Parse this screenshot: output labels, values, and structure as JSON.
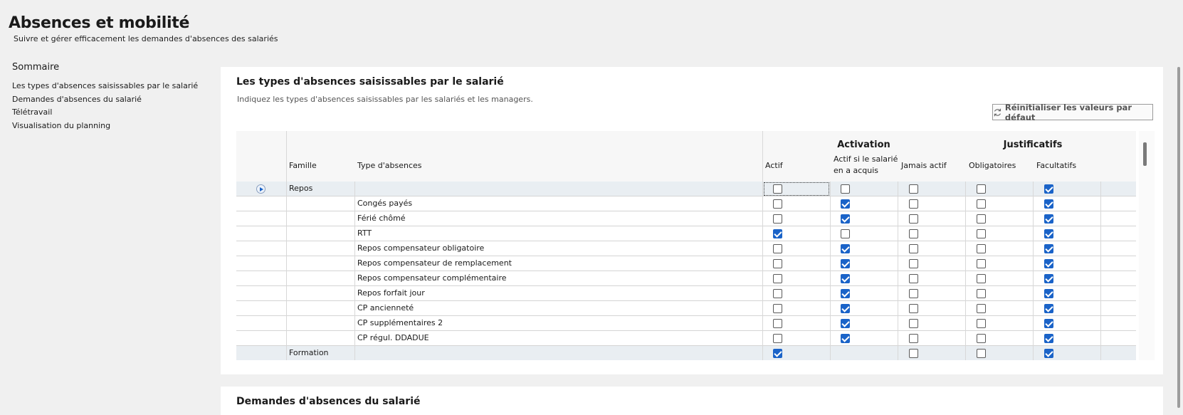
{
  "header": {
    "title": "Absences et mobilité",
    "subtitle": "Suivre et gérer efficacement les demandes d'absences des salariés"
  },
  "toc": {
    "title": "Sommaire",
    "items": [
      "Les types d'absences saisissables par le salarié",
      "Demandes d'absences du salarié",
      "Télétravail",
      "Visualisation du planning"
    ]
  },
  "section1": {
    "title": "Les types d'absences saisissables par le salarié",
    "description": "Indiquez les types d'absences saisissables par les salariés et les managers.",
    "reset_label": "Réinitialiser les valeurs par défaut",
    "reset_icon": "refresh-icon",
    "grid": {
      "groups": {
        "activation": "Activation",
        "justificatifs": "Justificatifs"
      },
      "columns": {
        "famille": "Famille",
        "type": "Type d'absences",
        "actif": "Actif",
        "actif_si_l1": "Actif si le salarié",
        "actif_si_l2": "en a acquis",
        "jamais": "Jamais actif",
        "obligatoires": "Obligatoires",
        "facultatifs": "Facultatifs"
      },
      "rows": [
        {
          "famille": "Repos",
          "type": "",
          "is_family": true,
          "current": true,
          "checks": [
            false,
            false,
            false,
            false,
            true
          ]
        },
        {
          "famille": "",
          "type": "Congés payés",
          "checks": [
            false,
            true,
            false,
            false,
            true
          ]
        },
        {
          "famille": "",
          "type": "Férié chômé",
          "checks": [
            false,
            true,
            false,
            false,
            true
          ]
        },
        {
          "famille": "",
          "type": "RTT",
          "checks": [
            true,
            false,
            false,
            false,
            true
          ]
        },
        {
          "famille": "",
          "type": "Repos compensateur obligatoire",
          "checks": [
            false,
            true,
            false,
            false,
            true
          ]
        },
        {
          "famille": "",
          "type": "Repos compensateur de remplacement",
          "checks": [
            false,
            true,
            false,
            false,
            true
          ]
        },
        {
          "famille": "",
          "type": "Repos compensateur complémentaire",
          "checks": [
            false,
            true,
            false,
            false,
            true
          ]
        },
        {
          "famille": "",
          "type": "Repos forfait jour",
          "checks": [
            false,
            true,
            false,
            false,
            true
          ]
        },
        {
          "famille": "",
          "type": "CP ancienneté",
          "checks": [
            false,
            true,
            false,
            false,
            true
          ]
        },
        {
          "famille": "",
          "type": "CP supplémentaires 2",
          "checks": [
            false,
            true,
            false,
            false,
            true
          ]
        },
        {
          "famille": "",
          "type": "CP régul. DDADUE",
          "checks": [
            false,
            true,
            false,
            false,
            true
          ]
        },
        {
          "famille": "Formation",
          "type": "",
          "is_family": true,
          "checks": [
            true,
            null,
            false,
            false,
            true
          ]
        }
      ]
    }
  },
  "section2": {
    "title": "Demandes d'absences du salarié"
  },
  "colors": {
    "accent": "#1a63c8",
    "background": "#f0f0f0",
    "card": "#ffffff",
    "family_row": "#e9eef2"
  }
}
